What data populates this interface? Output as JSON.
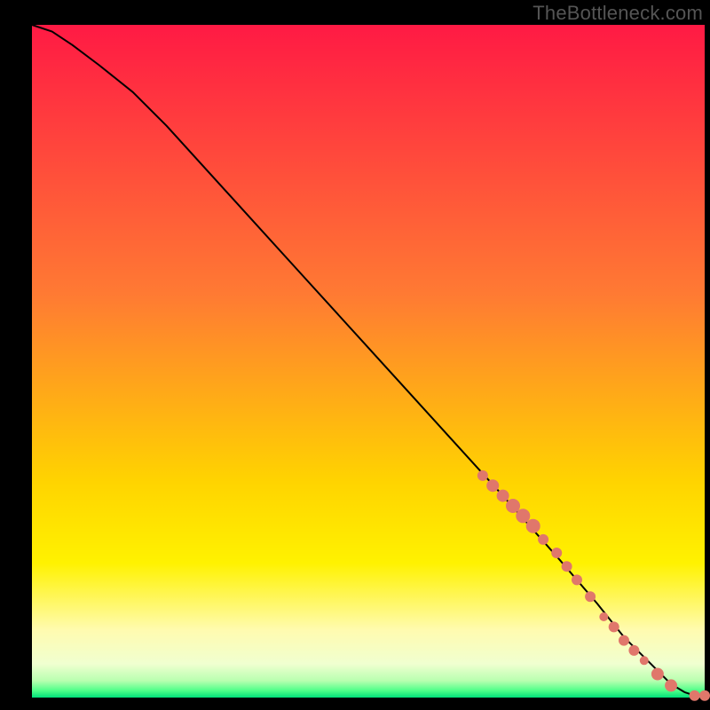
{
  "attribution": "TheBottleneck.com",
  "chart_data": {
    "type": "line",
    "xlim": [
      0,
      100
    ],
    "ylim": [
      0,
      100
    ],
    "xlabel": "",
    "ylabel": "",
    "title": "",
    "grid": false,
    "series": [
      {
        "name": "curve",
        "x": [
          0,
          3,
          6,
          10,
          15,
          20,
          30,
          40,
          50,
          60,
          70,
          78,
          84,
          88,
          92,
          95,
          97,
          98.5,
          100
        ],
        "y": [
          100,
          99,
          97,
          94,
          90,
          85,
          74,
          63,
          52,
          41,
          30,
          21,
          14,
          9,
          5,
          2,
          0.8,
          0.3,
          0.3
        ]
      }
    ],
    "scatter": {
      "name": "highlighted-points",
      "color": "#e0776b",
      "points": [
        {
          "x": 67,
          "y": 33,
          "r": 6
        },
        {
          "x": 68.5,
          "y": 31.5,
          "r": 7
        },
        {
          "x": 70,
          "y": 30,
          "r": 7
        },
        {
          "x": 71.5,
          "y": 28.5,
          "r": 8
        },
        {
          "x": 73,
          "y": 27,
          "r": 8
        },
        {
          "x": 74.5,
          "y": 25.5,
          "r": 8
        },
        {
          "x": 76,
          "y": 23.5,
          "r": 6
        },
        {
          "x": 78,
          "y": 21.5,
          "r": 6
        },
        {
          "x": 79.5,
          "y": 19.5,
          "r": 6
        },
        {
          "x": 81,
          "y": 17.5,
          "r": 6
        },
        {
          "x": 83,
          "y": 15,
          "r": 6
        },
        {
          "x": 85,
          "y": 12,
          "r": 5
        },
        {
          "x": 86.5,
          "y": 10.5,
          "r": 6
        },
        {
          "x": 88,
          "y": 8.5,
          "r": 6
        },
        {
          "x": 89.5,
          "y": 7,
          "r": 6
        },
        {
          "x": 91,
          "y": 5.5,
          "r": 5
        },
        {
          "x": 93,
          "y": 3.5,
          "r": 7
        },
        {
          "x": 95,
          "y": 1.8,
          "r": 7
        },
        {
          "x": 98.5,
          "y": 0.3,
          "r": 6
        },
        {
          "x": 100,
          "y": 0.3,
          "r": 6
        }
      ]
    },
    "gradient_stops": [
      {
        "pos": 0,
        "color": "#ff1a44"
      },
      {
        "pos": 0.4,
        "color": "#ff7a33"
      },
      {
        "pos": 0.68,
        "color": "#ffd400"
      },
      {
        "pos": 0.8,
        "color": "#fff200"
      },
      {
        "pos": 0.9,
        "color": "#fffbb0"
      },
      {
        "pos": 0.95,
        "color": "#f0ffd0"
      },
      {
        "pos": 0.975,
        "color": "#b8ffb0"
      },
      {
        "pos": 0.99,
        "color": "#4cff88"
      },
      {
        "pos": 1.0,
        "color": "#00e07a"
      }
    ]
  }
}
